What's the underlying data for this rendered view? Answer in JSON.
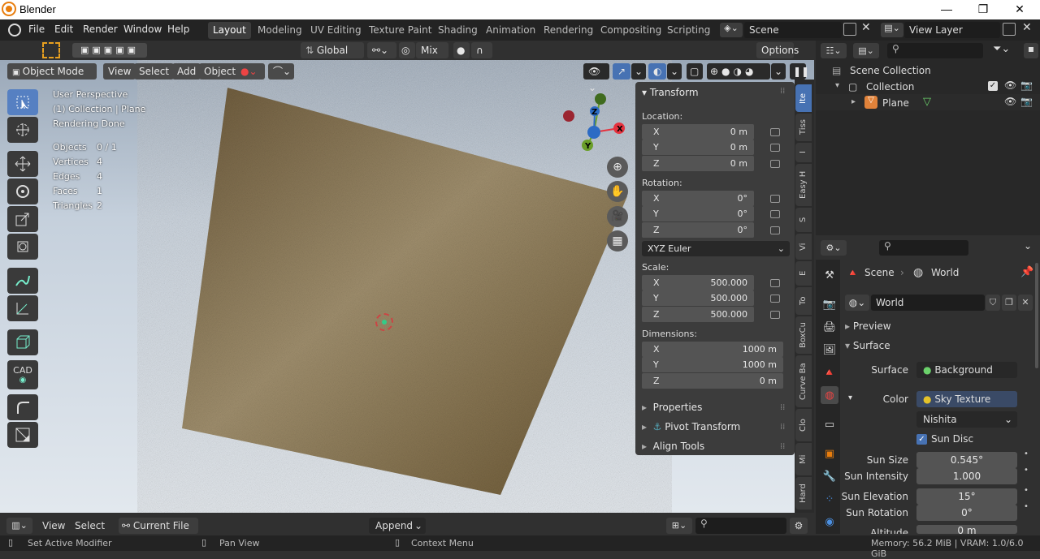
{
  "window": {
    "title": "Blender",
    "minimize": "—",
    "maximize": "❐",
    "close": "✕"
  },
  "menu": [
    "File",
    "Edit",
    "Render",
    "Window",
    "Help"
  ],
  "workspaces": [
    "Layout",
    "Modeling",
    "UV Editing",
    "Texture Paint",
    "Shading",
    "Animation",
    "Rendering",
    "Compositing",
    "Scripting"
  ],
  "scene": {
    "name": "Scene",
    "view_layer": "View Layer"
  },
  "toolheader": {
    "orientation": "Global",
    "snap_mode": "Mix",
    "options": "Options"
  },
  "viewport_header": {
    "mode": "Object Mode",
    "view": "View",
    "select": "Select",
    "add": "Add",
    "object": "Object"
  },
  "overlay_text": {
    "perspective": "User Perspective",
    "collection": "(1) Collection | Plane",
    "status": "Rendering Done",
    "stats": [
      {
        "label": "Objects",
        "value": "0 / 1"
      },
      {
        "label": "Vertices",
        "value": "4"
      },
      {
        "label": "Edges",
        "value": "4"
      },
      {
        "label": "Faces",
        "value": "1"
      },
      {
        "label": "Triangles",
        "value": "2"
      }
    ]
  },
  "gizmo": {
    "x": "X",
    "y": "Y",
    "z": "Z"
  },
  "transform": {
    "title": "Transform",
    "location_label": "Location:",
    "location": [
      {
        "axis": "X",
        "value": "0 m"
      },
      {
        "axis": "Y",
        "value": "0 m"
      },
      {
        "axis": "Z",
        "value": "0 m"
      }
    ],
    "rotation_label": "Rotation:",
    "rotation": [
      {
        "axis": "X",
        "value": "0°"
      },
      {
        "axis": "Y",
        "value": "0°"
      },
      {
        "axis": "Z",
        "value": "0°"
      }
    ],
    "rotation_mode": "XYZ Euler",
    "scale_label": "Scale:",
    "scale": [
      {
        "axis": "X",
        "value": "500.000"
      },
      {
        "axis": "Y",
        "value": "500.000"
      },
      {
        "axis": "Z",
        "value": "500.000"
      }
    ],
    "dimensions_label": "Dimensions:",
    "dimensions": [
      {
        "axis": "X",
        "value": "1000 m"
      },
      {
        "axis": "Y",
        "value": "1000 m"
      },
      {
        "axis": "Z",
        "value": "0 m"
      }
    ],
    "sections": [
      "Properties",
      "Pivot Transform",
      "Align Tools"
    ]
  },
  "side_tabs": [
    "Ite",
    "Tiss",
    "I",
    "Easy H",
    "S",
    "Vi",
    "E",
    "To",
    "BoxCu",
    "Curve Ba",
    "Clo",
    "Mi",
    "Hard"
  ],
  "outliner": {
    "root": "Scene Collection",
    "collection": "Collection",
    "object": "Plane"
  },
  "properties": {
    "breadcrumb_scene": "Scene",
    "breadcrumb_world": "World",
    "world_name": "World",
    "preview": "Preview",
    "surface_section": "Surface",
    "surface_label": "Surface",
    "surface_value": "Background",
    "color_label": "Color",
    "color_value": "Sky Texture",
    "sky_type": "Nishita",
    "sun_disc": "Sun Disc",
    "rows": [
      {
        "label": "Sun Size",
        "value": "0.545°"
      },
      {
        "label": "Sun Intensity",
        "value": "1.000"
      },
      {
        "label": "Sun Elevation",
        "value": "15°"
      },
      {
        "label": "Sun Rotation",
        "value": "0°"
      },
      {
        "label": "Altitude",
        "value": "0 m"
      }
    ]
  },
  "filebrowser": {
    "view": "View",
    "select": "Select",
    "current_file": "Current File",
    "append": "Append"
  },
  "statusbar": {
    "left": "Set Active Modifier",
    "middle": "Pan View",
    "right": "Context Menu",
    "memory": "Memory: 56.2 MiB | VRAM: 1.0/6.0 GiB"
  },
  "colors": {
    "accent": "#4772b3",
    "x_axis": "#e5323e",
    "y_axis": "#6a9e29",
    "z_axis": "#2c6bc4",
    "plane": "#8b7650"
  }
}
